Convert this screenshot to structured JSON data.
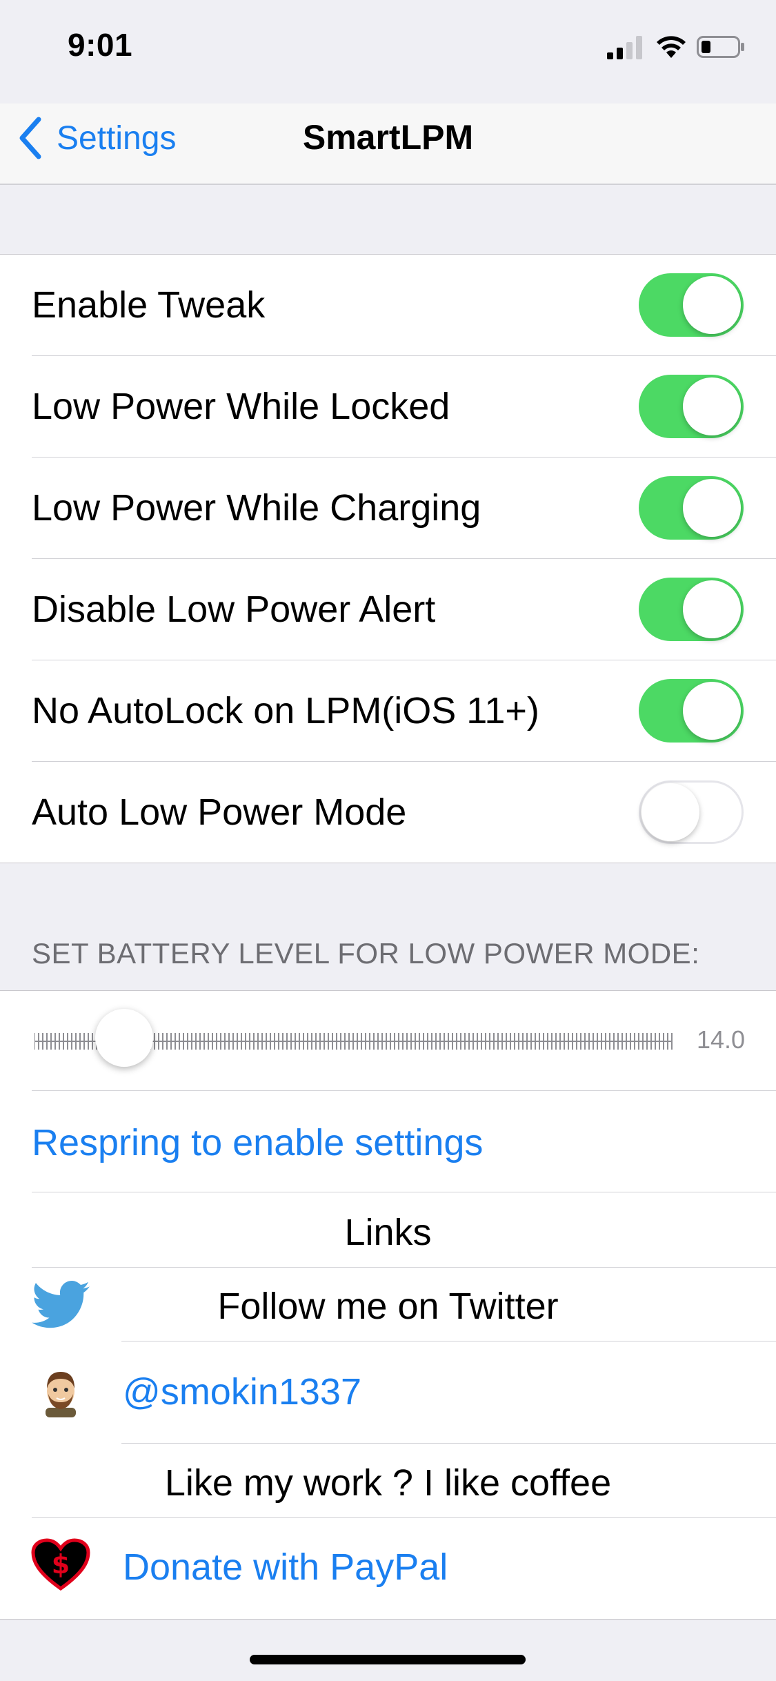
{
  "status_bar": {
    "time": "9:01"
  },
  "nav": {
    "back_label": "Settings",
    "title": "SmartLPM"
  },
  "toggles": [
    {
      "label": "Enable Tweak",
      "on": true
    },
    {
      "label": "Low Power While Locked",
      "on": true
    },
    {
      "label": "Low Power While Charging",
      "on": true
    },
    {
      "label": "Disable Low Power Alert",
      "on": true
    },
    {
      "label": "No AutoLock on LPM(iOS 11+)",
      "on": true
    },
    {
      "label": "Auto Low Power Mode",
      "on": false
    }
  ],
  "battery_section": {
    "header": "SET BATTERY LEVEL FOR LOW POWER MODE:",
    "slider_value": "14.0",
    "slider_fraction": 0.14
  },
  "respring_label": "Respring to enable settings",
  "links": {
    "header": "Links",
    "twitter_label": "Follow me on Twitter",
    "handle": "@smokin1337",
    "coffee_label": "Like my work ? I like coffee",
    "donate_label": "Donate with PayPal"
  },
  "icons": {
    "back": "chevron-left-icon",
    "twitter": "twitter-bird-icon",
    "avatar": "avatar-icon",
    "heart": "heart-dollar-icon"
  },
  "colors": {
    "accent": "#1a7ff0",
    "toggle_on": "#4cd964",
    "twitter": "#4aa3df"
  }
}
